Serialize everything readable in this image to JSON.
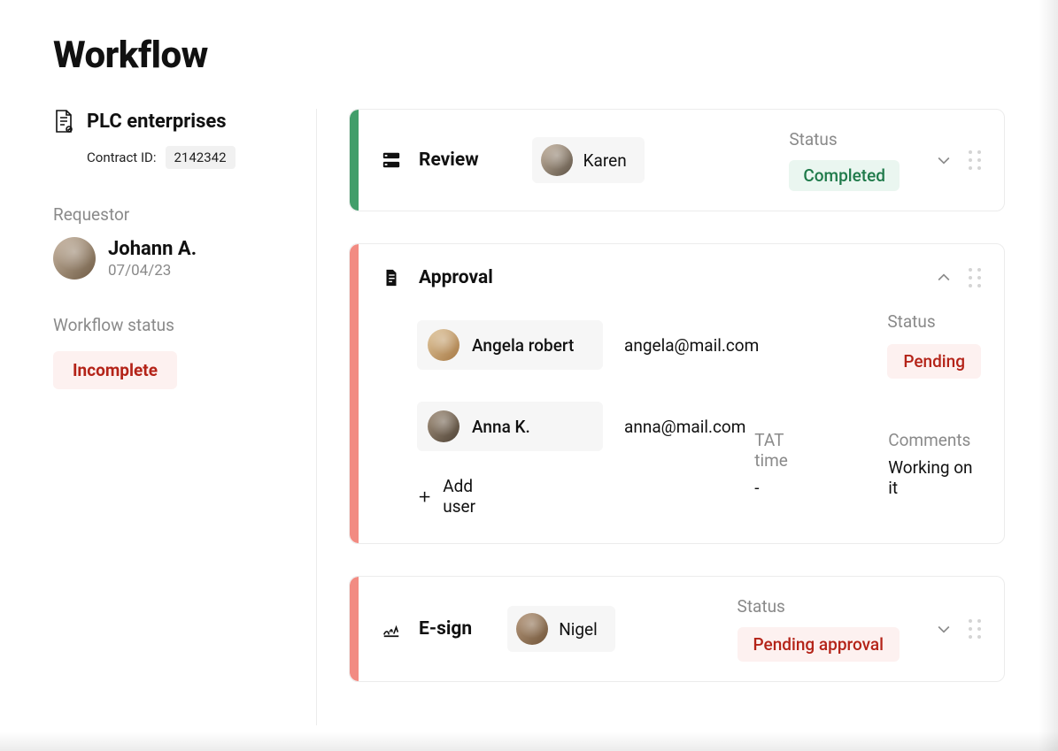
{
  "title": "Workflow",
  "company": {
    "name": "PLC enterprises",
    "contract_id_label": "Contract ID:",
    "contract_id": "2142342"
  },
  "requestor": {
    "section_label": "Requestor",
    "name": "Johann A.",
    "date": "07/04/23"
  },
  "workflow_status": {
    "section_label": "Workflow status",
    "value": "Incomplete"
  },
  "stages": {
    "review": {
      "title": "Review",
      "assignee": "Karen",
      "status_label": "Status",
      "status_value": "Completed"
    },
    "approval": {
      "title": "Approval",
      "users": [
        {
          "name": "Angela robert",
          "email": "angela@mail.com"
        },
        {
          "name": "Anna K.",
          "email": "anna@mail.com"
        }
      ],
      "status_label": "Status",
      "status_value": "Pending",
      "add_user_label": "Add user",
      "tat_label": "TAT time",
      "tat_value": "-",
      "comments_label": "Comments",
      "comments_value": "Working on it"
    },
    "esign": {
      "title": "E-sign",
      "assignee": "Nigel",
      "status_label": "Status",
      "status_value": "Pending approval"
    }
  }
}
